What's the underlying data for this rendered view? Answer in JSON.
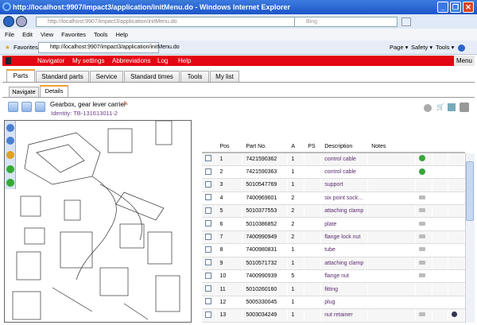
{
  "window": {
    "title": "http://localhost:9907/impact3/application/initMenu.do - Windows Internet Explorer"
  },
  "address": {
    "url": "http://localhost:9907/impact3/application/initMenu.do",
    "search_placeholder": "Bing"
  },
  "menubar": [
    "File",
    "Edit",
    "View",
    "Favorites",
    "Tools",
    "Help"
  ],
  "favorites": {
    "label": "Favorites",
    "tab": "http://localhost:9907/impact3/application/initMenu.do",
    "cmd": [
      "Page ▾",
      "Safety ▾",
      "Tools ▾"
    ]
  },
  "nav": {
    "items": [
      "Navigator",
      "My settings",
      "Abbreviations",
      "Log",
      "Help"
    ],
    "menu": "Menu"
  },
  "tabs": [
    "Parts",
    "Standard parts",
    "Service",
    "Standard times",
    "Tools",
    "My list"
  ],
  "subtabs": [
    "Navigate",
    "Details"
  ],
  "header": {
    "title": "Gearbox, gear lever carrier",
    "identity": "Identity: TB-131613011-2"
  },
  "table": {
    "columns": [
      "Pos",
      "Part No.",
      "A",
      "PS",
      "Description",
      "Notes"
    ],
    "rows": [
      {
        "pos": "1",
        "part": "7421590362",
        "a": "1",
        "desc": "control cable",
        "icon": "go"
      },
      {
        "pos": "2",
        "part": "7421590363",
        "a": "1",
        "desc": "control cable",
        "icon": "go"
      },
      {
        "pos": "3",
        "part": "5010547769",
        "a": "1",
        "desc": "support",
        "icon": ""
      },
      {
        "pos": "4",
        "part": "7400969601",
        "a": "2",
        "desc": "six point sock…",
        "icon": "sp"
      },
      {
        "pos": "5",
        "part": "5010377553",
        "a": "2",
        "desc": "attaching clamp",
        "icon": "sp"
      },
      {
        "pos": "6",
        "part": "5010386852",
        "a": "2",
        "desc": "plate",
        "icon": "sp"
      },
      {
        "pos": "7",
        "part": "7400990949",
        "a": "2",
        "desc": "flange lock nut",
        "icon": "sp"
      },
      {
        "pos": "8",
        "part": "7400980831",
        "a": "1",
        "desc": "tube",
        "icon": "sp"
      },
      {
        "pos": "9",
        "part": "5010571732",
        "a": "1",
        "desc": "attaching clamp",
        "icon": "sp"
      },
      {
        "pos": "10",
        "part": "7400990939",
        "a": "5",
        "desc": "flange nut",
        "icon": "sp"
      },
      {
        "pos": "11",
        "part": "5010260160",
        "a": "1",
        "desc": "fitting",
        "icon": ""
      },
      {
        "pos": "12",
        "part": "5005330045",
        "a": "1",
        "desc": "plug",
        "icon": ""
      },
      {
        "pos": "13",
        "part": "5003034249",
        "a": "1",
        "desc": "nut retainer",
        "icon": "sp",
        "info": true
      }
    ]
  }
}
